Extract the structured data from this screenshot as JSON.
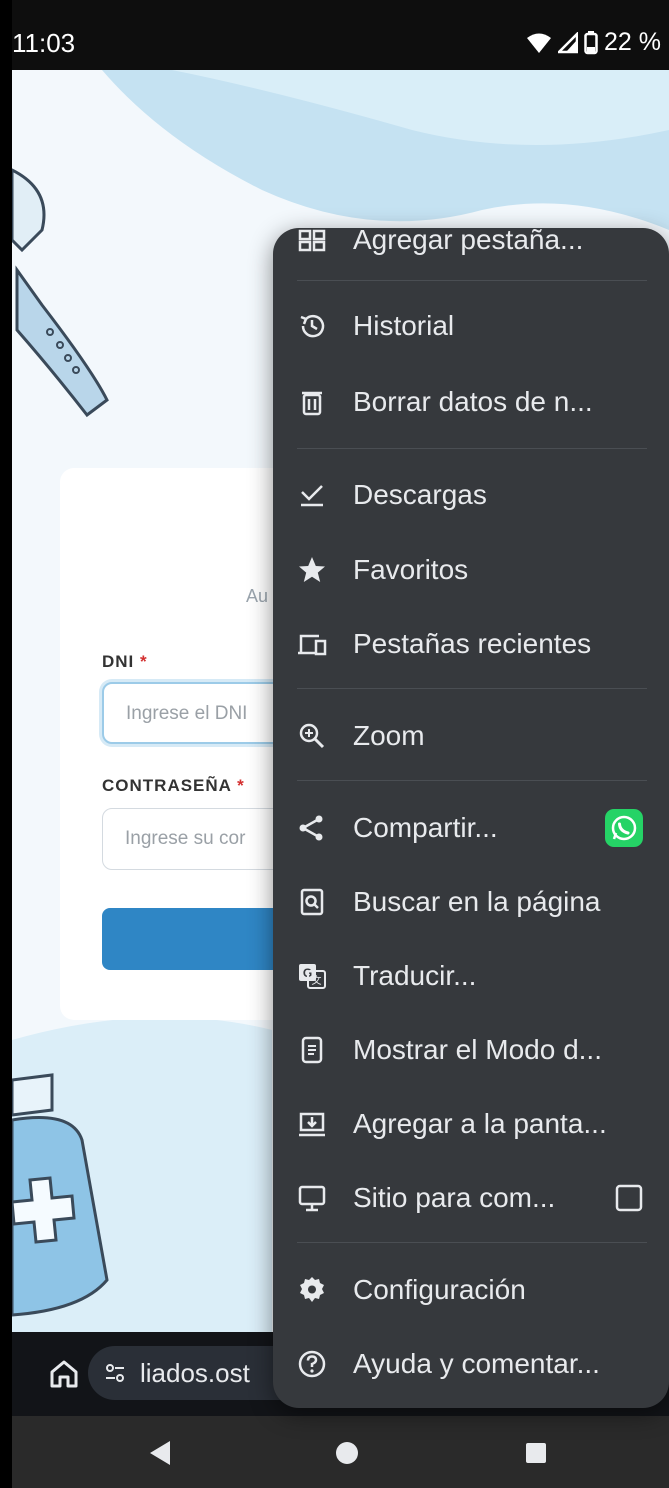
{
  "status_bar": {
    "time": "11:03",
    "battery": "22 %",
    "icons": [
      "wifi-icon",
      "signal-icon",
      "battery-icon"
    ]
  },
  "page": {
    "auth_text": "Au",
    "dni_label": "DNI",
    "required_mark": "*",
    "dni_placeholder": "Ingrese el DNI",
    "password_label": "CONTRASEÑA",
    "password_placeholder": "Ingrese su cor",
    "accent_color": "#2f86c5"
  },
  "url_bar": {
    "url": "liados.ost"
  },
  "menu": {
    "items": [
      {
        "label": "Agregar pestaña...",
        "icon": "new-tab-icon"
      },
      {
        "label": "Historial",
        "icon": "history-icon"
      },
      {
        "label": "Borrar datos de n...",
        "icon": "trash-icon"
      },
      {
        "label": "Descargas",
        "icon": "download-icon"
      },
      {
        "label": "Favoritos",
        "icon": "star-icon"
      },
      {
        "label": "Pestañas recientes",
        "icon": "devices-icon"
      },
      {
        "label": "Zoom",
        "icon": "zoom-icon"
      },
      {
        "label": "Compartir...",
        "icon": "share-icon"
      },
      {
        "label": "Buscar en la página",
        "icon": "find-in-page-icon"
      },
      {
        "label": "Traducir...",
        "icon": "translate-icon"
      },
      {
        "label": "Mostrar el Modo d...",
        "icon": "reader-mode-icon"
      },
      {
        "label": "Agregar a la panta...",
        "icon": "add-to-home-icon"
      },
      {
        "label": "Sitio para com...",
        "icon": "desktop-icon"
      },
      {
        "label": "Configuración",
        "icon": "gear-icon"
      },
      {
        "label": "Ayuda y comentar...",
        "icon": "help-icon"
      }
    ],
    "whatsapp_color": "#25d366"
  }
}
